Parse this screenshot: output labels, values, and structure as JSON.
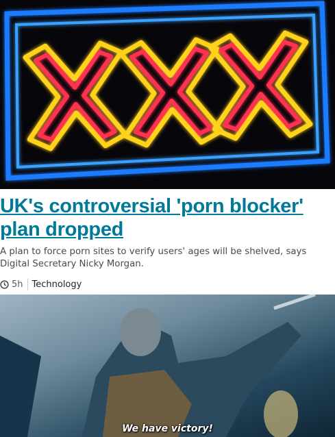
{
  "article": {
    "headline": "UK's controversial 'porn blocker' plan dropped",
    "summary": "A plan to force porn sites to verify users' ages will be shelved, says Digital Secretary Nicky Morgan.",
    "time": "5h",
    "topic": "Technology",
    "accent_color": "#007a99"
  },
  "hero_image": {
    "sign_text": "XXX"
  },
  "gif": {
    "caption": "We have victory!"
  }
}
